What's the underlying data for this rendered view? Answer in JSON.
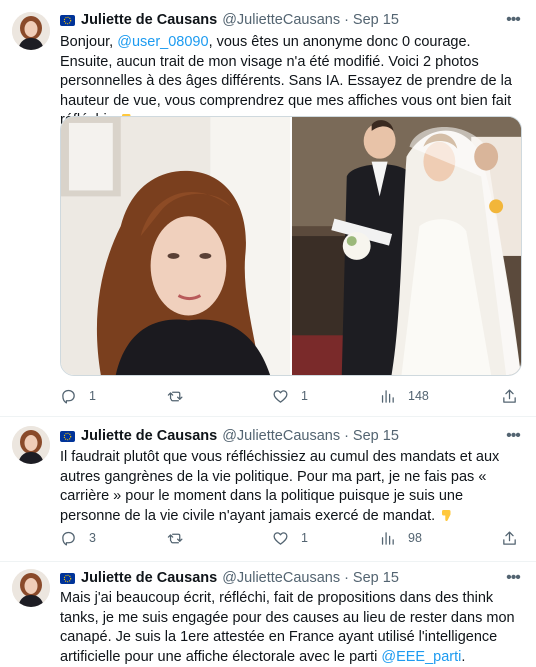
{
  "tweets": [
    {
      "author": "Juliette de Causans",
      "handle": "@JulietteCausans",
      "separator": "·",
      "time": "Sep 15",
      "text_before": "Bonjour, ",
      "mention": "@user_08090",
      "text_after": ", vous êtes un anonyme donc 0 courage. Ensuite, aucun trait de mon visage n'a été modifié. Voici 2 photos personnelles à des âges différents. Sans IA. Essayez de prendre de la hauteur de vue, vous comprendrez que mes affiches vous ont bien fait réfléchir. ",
      "replies": "1",
      "retweets": "",
      "likes": "1",
      "views": "148"
    },
    {
      "author": "Juliette de Causans",
      "handle": "@JulietteCausans",
      "separator": "·",
      "time": "Sep 15",
      "text": "Il faudrait plutôt que vous réfléchissiez au cumul des mandats et aux autres gangrènes de la vie politique. Pour ma part, je ne fais pas « carrière » pour le moment dans la politique puisque je suis une personne de la vie civile n'ayant jamais exercé de mandat. ",
      "replies": "3",
      "retweets": "",
      "likes": "1",
      "views": "98"
    },
    {
      "author": "Juliette de Causans",
      "handle": "@JulietteCausans",
      "separator": "·",
      "time": "Sep 15",
      "text_before": "Mais j'ai beaucoup écrit, réfléchi, fait de propositions dans des think tanks, je me suis engagée pour des causes au lieu de rester dans mon canapé. Je suis la 1ere attestée en France ayant utilisé l'intelligence artificielle pour une affiche électorale avec le parti ",
      "mention": "@EEE_parti",
      "text_after": "."
    }
  ],
  "icons": {
    "flag": "eu-flag-icon",
    "more": "more-icon",
    "reply": "reply-icon",
    "retweet": "retweet-icon",
    "like": "heart-icon",
    "views": "views-icon",
    "share": "share-icon",
    "emoji": "backhand-index-pointing-down-emoji"
  },
  "colors": {
    "link": "#1d9bf0",
    "secondary_text": "#536471",
    "primary_text": "#0f1419",
    "flag_blue": "#003399",
    "flag_star": "#ffcc00"
  }
}
